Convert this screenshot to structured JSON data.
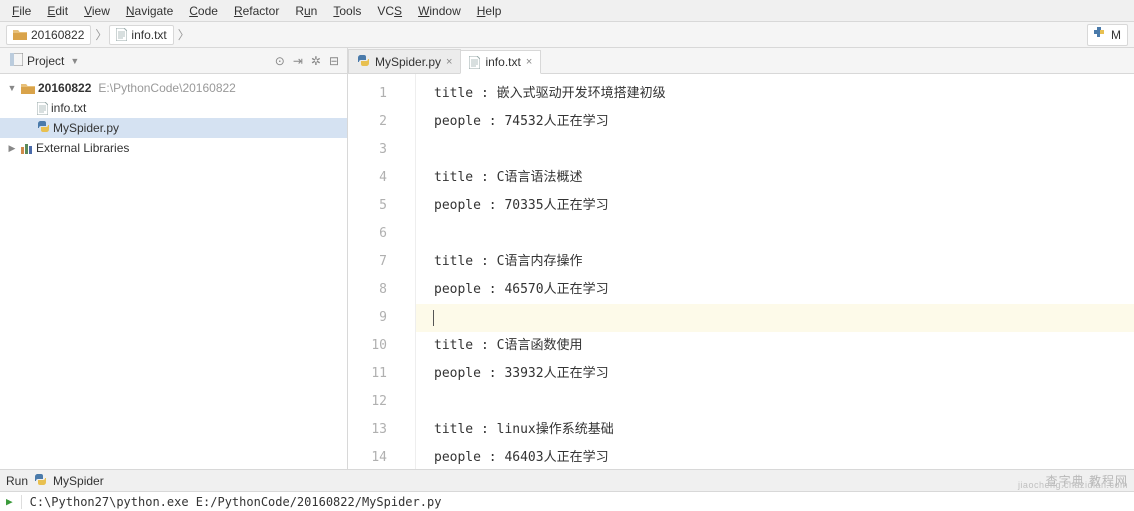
{
  "menu": {
    "items": [
      "File",
      "Edit",
      "View",
      "Navigate",
      "Code",
      "Refactor",
      "Run",
      "Tools",
      "VCS",
      "Window",
      "Help"
    ]
  },
  "breadcrumb": {
    "root": "20160822",
    "file": "info.txt",
    "right_label": "M"
  },
  "sidebar": {
    "title": "Project",
    "tools": {
      "target": "⊙",
      "collapse": "⇥",
      "settings": "✲",
      "hide": "⊟"
    }
  },
  "tree": {
    "project": {
      "name": "20160822",
      "path": "E:\\PythonCode\\20160822"
    },
    "files": [
      {
        "name": "info.txt",
        "type": "txt",
        "selected": false
      },
      {
        "name": "MySpider.py",
        "type": "py",
        "selected": true
      }
    ],
    "external": "External Libraries"
  },
  "tabs": [
    {
      "label": "MySpider.py",
      "type": "py",
      "active": false
    },
    {
      "label": "info.txt",
      "type": "txt",
      "active": true
    }
  ],
  "editor": {
    "cursor_line": 9,
    "lines": [
      "title : 嵌入式驱动开发环境搭建初级",
      "people : 74532人正在学习",
      "",
      "title : C语言语法概述",
      "people : 70335人正在学习",
      "",
      "title : C语言内存操作",
      "people : 46570人正在学习",
      "",
      "title : C语言函数使用",
      "people : 33932人正在学习",
      "",
      "title : linux操作系统基础",
      "people : 46403人正在学习"
    ]
  },
  "status": {
    "run_label": "Run",
    "run_config": "MySpider",
    "watermark": "查字典 教程网",
    "watermark_sub": "jiaocheng.chazidian.com"
  },
  "console": {
    "command": "C:\\Python27\\python.exe E:/PythonCode/20160822/MySpider.py"
  },
  "icons": {
    "project": "project-panel-icon"
  }
}
